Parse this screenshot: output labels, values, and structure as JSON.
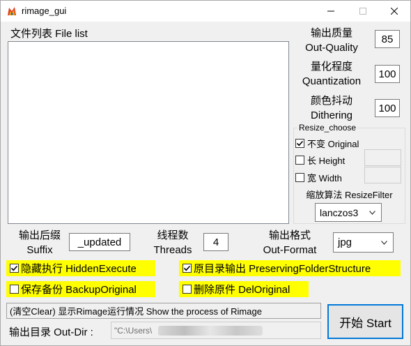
{
  "window": {
    "title": "rimage_gui",
    "icon": "rimage-app-icon",
    "controls": [
      "minimize-icon",
      "maximize-icon",
      "close-icon"
    ]
  },
  "file_list": {
    "label": "文件列表 File list",
    "items": []
  },
  "quality": {
    "label_cn": "输出质量",
    "label_en": "Out-Quality",
    "value": "85"
  },
  "quantization": {
    "label_cn": "量化程度",
    "label_en": "Quantization",
    "value": "100"
  },
  "dithering": {
    "label_cn": "颜色抖动",
    "label_en": "Dithering",
    "value": "100"
  },
  "resize": {
    "legend": "Resize_choose",
    "original": {
      "label": "不变 Original",
      "checked": true
    },
    "height": {
      "label": "长 Height",
      "checked": false,
      "value": ""
    },
    "width": {
      "label": "宽 Width",
      "checked": false,
      "value": ""
    },
    "filter_label": "缩放算法 ResizeFilter",
    "filter_value": "lanczos3"
  },
  "suffix": {
    "label_cn": "输出后缀",
    "label_en": "Suffix",
    "value": "_updated"
  },
  "threads": {
    "label_cn": "线程数",
    "label_en": "Threads",
    "value": "4"
  },
  "format": {
    "label_cn": "输出格式",
    "label_en": "Out-Format",
    "value": "jpg"
  },
  "options": {
    "hidden_execute": {
      "label": "隐藏执行 HiddenExecute",
      "checked": true
    },
    "preserve_folder": {
      "label": "原目录输出 PreservingFolderStructure",
      "checked": true
    },
    "backup_original": {
      "label": "保存备份 BackupOriginal",
      "checked": false
    },
    "del_original": {
      "label": "删除原件 DelOriginal",
      "checked": false
    }
  },
  "status_text": "(清空Clear) 显示Rimage运行情况 Show the process of Rimage",
  "outdir": {
    "label": "输出目录 Out-Dir :",
    "value": "\"C:\\Users\\"
  },
  "start_label": "开始 Start",
  "colors": {
    "highlight": "#ffff00",
    "accent": "#0078d7"
  }
}
